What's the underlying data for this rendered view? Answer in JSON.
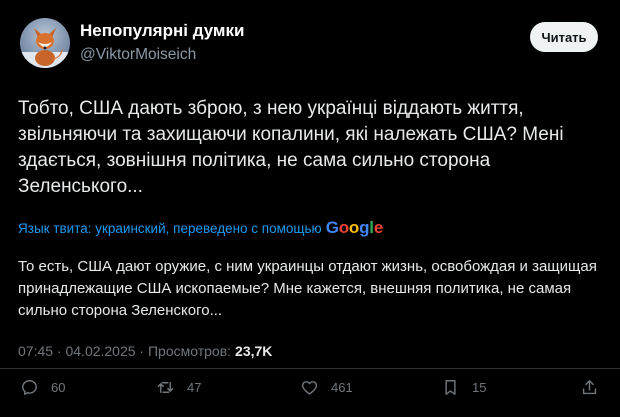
{
  "author": {
    "display_name": "Непопулярні думки",
    "handle": "@ViktorMoiseich"
  },
  "follow_button": {
    "label": "Читать"
  },
  "tweet": {
    "text": "Тобто, США дають зброю, з нею українці віддають життя, звільняючи та захищаючи копалини, які належать США? Мені здається, зовнішня політика, не сама сильно сторона Зеленського..."
  },
  "translation": {
    "note": "Язык твита: украинский, переведено с помощью",
    "provider_letters": [
      "G",
      "o",
      "o",
      "g",
      "l",
      "e"
    ],
    "text": "То есть, США дают оружие, с ним украинцы отдают жизнь, освобождая и защищая принадлежащие США ископаемые? Мне кажется, внешняя политика, не самая сильно сторона Зеленского..."
  },
  "meta": {
    "time_date": "07:45 · 04.02.2025 · Просмотров:",
    "views": "23,7K"
  },
  "actions": {
    "replies": "60",
    "reposts": "47",
    "likes": "461",
    "bookmarks": "15"
  },
  "icons": {
    "reply": "reply-icon",
    "repost": "repost-icon",
    "like": "heart-icon",
    "bookmark": "bookmark-icon",
    "share": "share-icon"
  },
  "colors": {
    "background": "#000000",
    "link_blue": "#1d9bf0",
    "muted": "#71767b"
  }
}
